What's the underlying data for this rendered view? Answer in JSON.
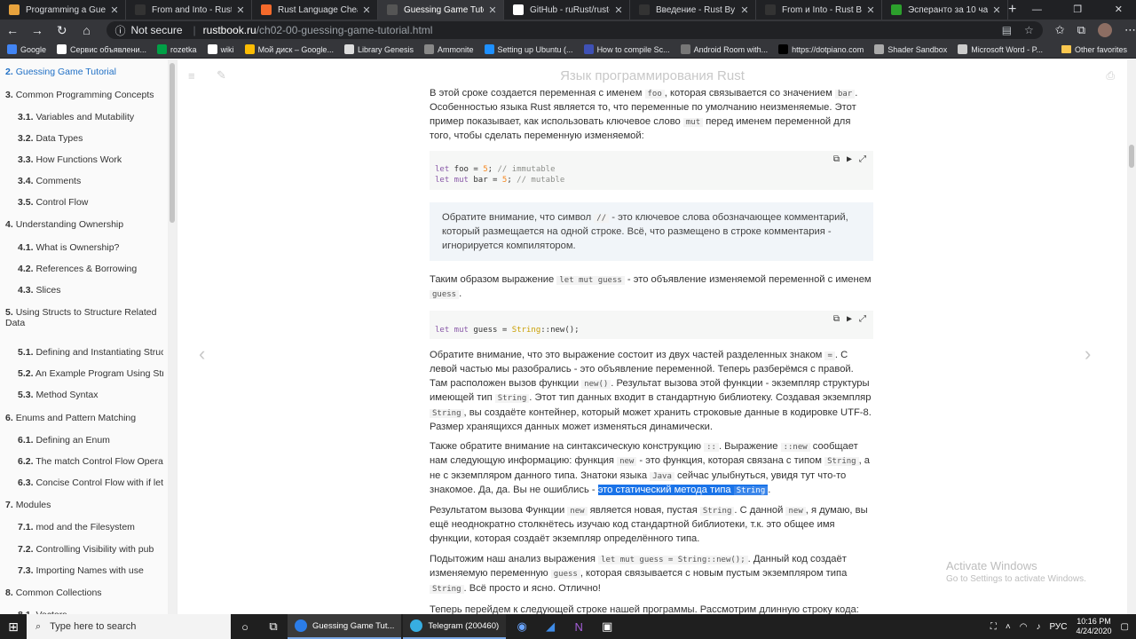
{
  "browser": {
    "tabs": [
      {
        "title": "Programming a Guessing G",
        "color": "#e8a33d",
        "active": false
      },
      {
        "title": "From and Into - Rust By Ex",
        "color": "#333333",
        "active": false
      },
      {
        "title": "Rust Language Cheat Sheet",
        "color": "#f56a2b",
        "active": false
      },
      {
        "title": "Guessing Game Tutorial - Я",
        "color": "#555555",
        "active": true
      },
      {
        "title": "GitHub - ruRust/rust-by-ex",
        "color": "#ffffff",
        "active": false
      },
      {
        "title": "Введение - Rust By Exampl",
        "color": "#333333",
        "active": false
      },
      {
        "title": "From и Into - Rust By Exam",
        "color": "#333333",
        "active": false
      },
      {
        "title": "Эсперанто за 10 часов",
        "color": "#2ca02c",
        "active": false
      }
    ],
    "new_tab": "+",
    "window_controls": [
      "—",
      "❐",
      "✕"
    ],
    "security": "Not secure",
    "url_host": "rustbook.ru",
    "url_path": "/ch02-00-guessing-game-tutorial.html",
    "bookmarks": [
      {
        "label": "Google",
        "color": "#4285f4"
      },
      {
        "label": "Сервис объявлени...",
        "color": "#ffffff"
      },
      {
        "label": "rozetka",
        "color": "#00a046"
      },
      {
        "label": "wiki",
        "color": "#ffffff"
      },
      {
        "label": "Мой диск – Google...",
        "color": "#fbbc04"
      },
      {
        "label": "Library Genesis",
        "color": "#dddddd"
      },
      {
        "label": "Ammonite",
        "color": "#888888"
      },
      {
        "label": "Setting up Ubuntu (...",
        "color": "#1e90ff"
      },
      {
        "label": "How to compile Sc...",
        "color": "#3f51b5"
      },
      {
        "label": "Android Room with...",
        "color": "#777777"
      },
      {
        "label": "https://dotpiano.com",
        "color": "#000000"
      },
      {
        "label": "Shader Sandbox",
        "color": "#aaaaaa"
      },
      {
        "label": "Microsoft Word - P...",
        "color": "#cccccc"
      }
    ],
    "other_favorites": "Other favorites"
  },
  "toc": [
    {
      "num": "2.",
      "label": "Guessing Game Tutorial",
      "level": 1,
      "active": true
    },
    {
      "num": "3.",
      "label": "Common Programming Concepts",
      "level": 1
    },
    {
      "num": "3.1.",
      "label": "Variables and Mutability",
      "level": 2
    },
    {
      "num": "3.2.",
      "label": "Data Types",
      "level": 2
    },
    {
      "num": "3.3.",
      "label": "How Functions Work",
      "level": 2
    },
    {
      "num": "3.4.",
      "label": "Comments",
      "level": 2
    },
    {
      "num": "3.5.",
      "label": "Control Flow",
      "level": 2
    },
    {
      "num": "4.",
      "label": "Understanding Ownership",
      "level": 1
    },
    {
      "num": "4.1.",
      "label": "What is Ownership?",
      "level": 2
    },
    {
      "num": "4.2.",
      "label": "References & Borrowing",
      "level": 2
    },
    {
      "num": "4.3.",
      "label": "Slices",
      "level": 2
    },
    {
      "num": "5.",
      "label": "Using Structs to Structure Related",
      "label2": "Data",
      "level": 1
    },
    {
      "num": "5.1.",
      "label": "Defining and Instantiating Structs",
      "level": 2
    },
    {
      "num": "5.2.",
      "label": "An Example Program Using Struc",
      "level": 2
    },
    {
      "num": "5.3.",
      "label": "Method Syntax",
      "level": 2
    },
    {
      "num": "6.",
      "label": "Enums and Pattern Matching",
      "level": 1
    },
    {
      "num": "6.1.",
      "label": "Defining an Enum",
      "level": 2
    },
    {
      "num": "6.2.",
      "label": "The match Control Flow Operator",
      "level": 2
    },
    {
      "num": "6.3.",
      "label": "Concise Control Flow with if let",
      "level": 2
    },
    {
      "num": "7.",
      "label": "Modules",
      "level": 1
    },
    {
      "num": "7.1.",
      "label": "mod and the Filesystem",
      "level": 2
    },
    {
      "num": "7.2.",
      "label": "Controlling Visibility with pub",
      "level": 2
    },
    {
      "num": "7.3.",
      "label": "Importing Names with use",
      "level": 2
    },
    {
      "num": "8.",
      "label": "Common Collections",
      "level": 1
    },
    {
      "num": "8.1.",
      "label": "Vectors",
      "level": 2
    }
  ],
  "page": {
    "title": "Язык программирования Rust",
    "p1": {
      "a": "В этой сроке создается переменная с именем ",
      "c1": "foo",
      "b": ", которая связывается со значением ",
      "c2": "bar",
      "d": ". Особенностью языка Rust является то, что переменные по умолчанию неизменяемые. Этот пример показывает, как использовать ключевое слово ",
      "c3": "mut",
      "e": " перед именем переменной для того, чтобы сделать переменную изменяемой:"
    },
    "code1": {
      "l1_kw": "let",
      "l1_name": " foo = ",
      "l1_num": "5",
      "l1_semi": "; ",
      "l1_cmt": "// immutable",
      "l2_kw": "let",
      "l2_mut": " mut",
      "l2_name": " bar = ",
      "l2_num": "5",
      "l2_semi": "; ",
      "l2_cmt": "// mutable"
    },
    "note": {
      "a": "Обратите внимание, что символ ",
      "c1": "//",
      "b": " - это ключевое слова обозначающее комментарий, который размещается на одной строке. Всё, что размещено в строке комментария - игнорируется компилятором."
    },
    "p2": {
      "a": "Таким образом выражение ",
      "c1": "let mut guess",
      "b": " - это объявление изменяемой переменной с именем ",
      "c2": "guess",
      "d": "."
    },
    "code2": {
      "kw": "let",
      "mut": " mut",
      "name": " guess = ",
      "ty": "String",
      "rest": "::new();"
    },
    "p3": {
      "a": "Обратите внимание, что это выражение состоит из двух частей разделенных знаком ",
      "c1": "=",
      "b": ". С левой частью мы разобрались - это объявление переменной. Теперь разберёмся с правой. Там расположен вызов функции ",
      "c2": "new()",
      "d": ". Результат вызова этой функции - экземпляр структуры имеющей тип ",
      "c3": "String",
      "e": ". Этот тип данных входит в стандартную библиотеку. Создавая экземпляр ",
      "c4": "String",
      "f": ", вы создаёте контейнер, который может хранить строковые данные в кодировке UTF-8. Размер хранящихся данных может изменяться динамически."
    },
    "p4": {
      "a": "Также обратите внимание на синтаксическую конструкцию ",
      "c1": "::",
      "b": ". Выражение ",
      "c2": "::new",
      "c": " сообщает нам следующую информацию: функция ",
      "c3": "new",
      "d": " - это функция, которая связана с типом ",
      "c4": "String",
      "e": ", а не с экземпляром данного типа. Знатоки языка ",
      "c5": "Java",
      "f": " сейчас улыбнуться, увидя тут что-то знакомое. Да, да. Вы не ошиблись - ",
      "hl": "это статический метода типа ",
      "hl_code": "String",
      "g": "."
    },
    "p5": {
      "a": "Результатом вызова Функции ",
      "c1": "new",
      "b": " является новая, пустая ",
      "c2": "String",
      "c": ". С данной ",
      "c3": "new",
      "d": ", я думаю, вы ещё неоднократно столкнётесь изучаю код стандартной библиотеки, т.к. это общее имя функции, которая создаёт экземпляр определённого типа."
    },
    "p6": {
      "a": "Подытожим наш анализ выражения ",
      "c1": "let mut guess = String::new();",
      "b": ". Данный код создаёт изменяемую переменную ",
      "c2": "guess",
      "c": ", которая связывается с новым пустым экземпляром типа ",
      "c3": "String",
      "d": ". Всё просто и ясно. Отлично!"
    },
    "p7": "Теперь перейдем к следующей строке нашей программы. Рассмотрим длинную строку кода:"
  },
  "watermark": {
    "line1": "Activate Windows",
    "line2": "Go to Settings to activate Windows."
  },
  "taskbar": {
    "search_placeholder": "Type here to search",
    "app1": "Guessing Game Tut...",
    "app2": "Telegram (200460)",
    "lang": "РУС",
    "time": "10:16 PM",
    "date": "4/24/2020"
  }
}
